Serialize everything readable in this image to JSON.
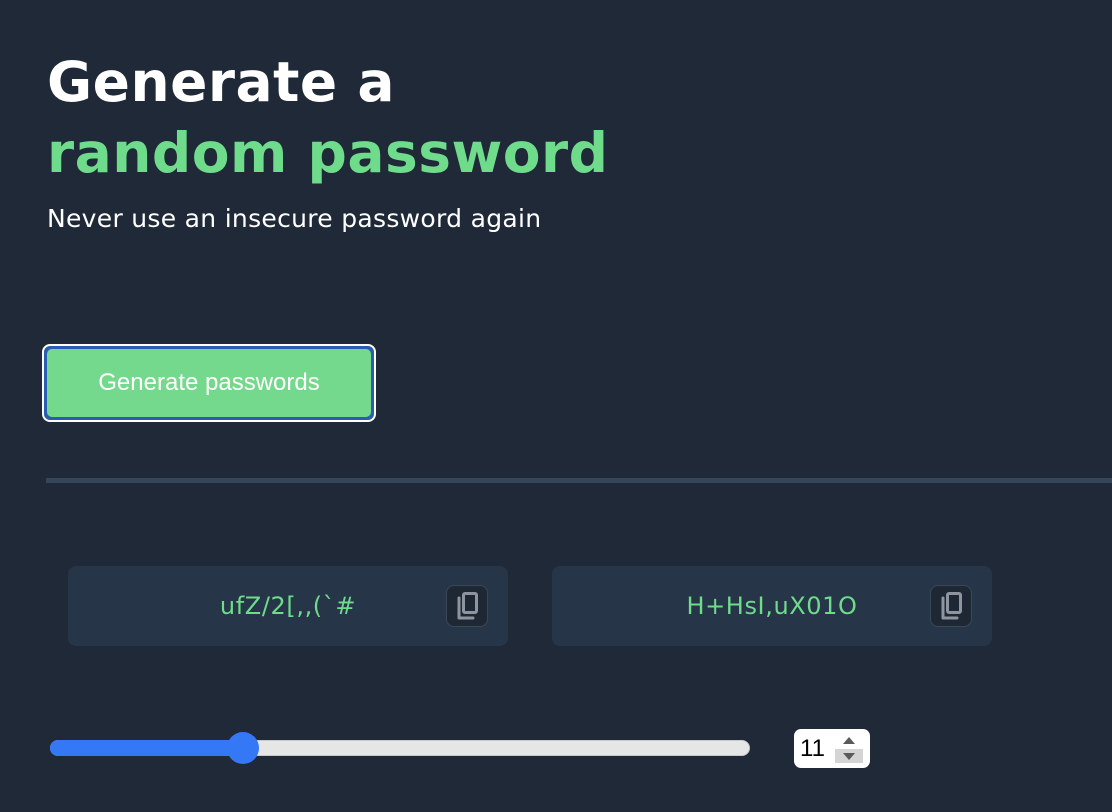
{
  "hero": {
    "headline_line1": "Generate a",
    "headline_line2": "random password",
    "subtitle": "Never use an insecure password again"
  },
  "actions": {
    "generate_label": "Generate passwords"
  },
  "passwords": [
    {
      "value": "ufZ/2[,,(`#",
      "copy_icon": "copy-icon"
    },
    {
      "value": "H+HsI,uX01O",
      "copy_icon": "copy-icon"
    }
  ],
  "length_control": {
    "value": "11",
    "slider_fraction": 0.275
  },
  "colors": {
    "background": "#1f2937",
    "accent_green": "#6fdc8c",
    "card": "#273549",
    "slider_blue": "#3478f6"
  }
}
